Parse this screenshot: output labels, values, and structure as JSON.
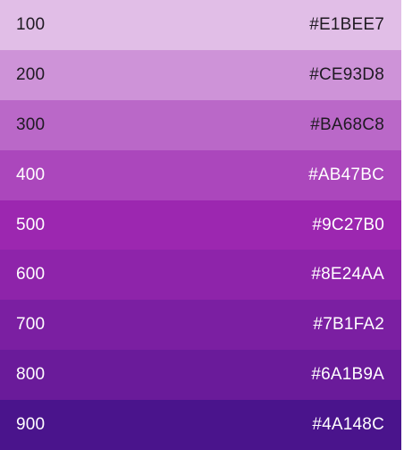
{
  "palette": {
    "swatches": [
      {
        "shade": "100",
        "hex": "#E1BEE7",
        "text_color": "dark-text"
      },
      {
        "shade": "200",
        "hex": "#CE93D8",
        "text_color": "dark-text"
      },
      {
        "shade": "300",
        "hex": "#BA68C8",
        "text_color": "dark-text"
      },
      {
        "shade": "400",
        "hex": "#AB47BC",
        "text_color": "white-text"
      },
      {
        "shade": "500",
        "hex": "#9C27B0",
        "text_color": "white-text"
      },
      {
        "shade": "600",
        "hex": "#8E24AA",
        "text_color": "white-text"
      },
      {
        "shade": "700",
        "hex": "#7B1FA2",
        "text_color": "white-text"
      },
      {
        "shade": "800",
        "hex": "#6A1B9A",
        "text_color": "white-text"
      },
      {
        "shade": "900",
        "hex": "#4A148C",
        "text_color": "white-text"
      }
    ]
  }
}
